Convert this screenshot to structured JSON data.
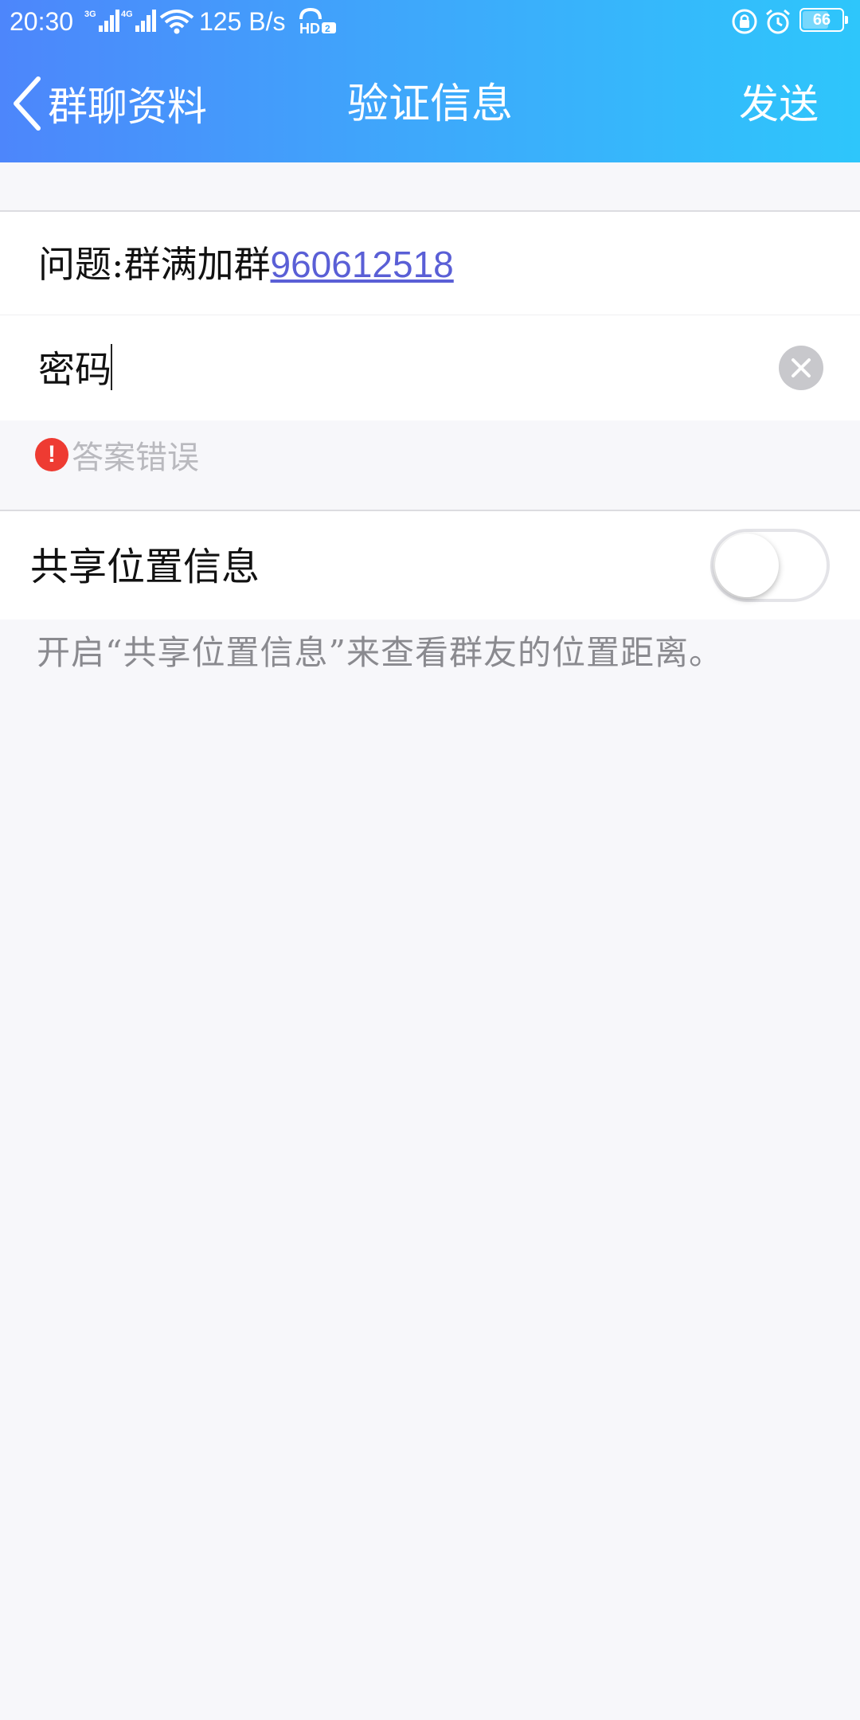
{
  "status_bar": {
    "time": "20:30",
    "network_1": "3G",
    "network_2": "4G",
    "speed": "125 B/s",
    "hd_label": "HD",
    "hd_sub": "2",
    "battery": "66",
    "battery_level": 0.66
  },
  "header": {
    "back_label": "群聊资料",
    "title": "验证信息",
    "send_label": "发送"
  },
  "question": {
    "prefix": "问题:群满加群",
    "link": "960612518"
  },
  "answer": {
    "value": "密码"
  },
  "error": {
    "icon": "!",
    "text": "答案错误"
  },
  "share_location": {
    "label": "共享位置信息",
    "enabled": false,
    "hint": "开启“共享位置信息”来查看群友的位置距离。"
  },
  "colors": {
    "header_gradient_start": "#4d86fb",
    "header_gradient_end": "#2ec6fb",
    "link": "#5a5fd6",
    "error": "#ee3b32"
  }
}
